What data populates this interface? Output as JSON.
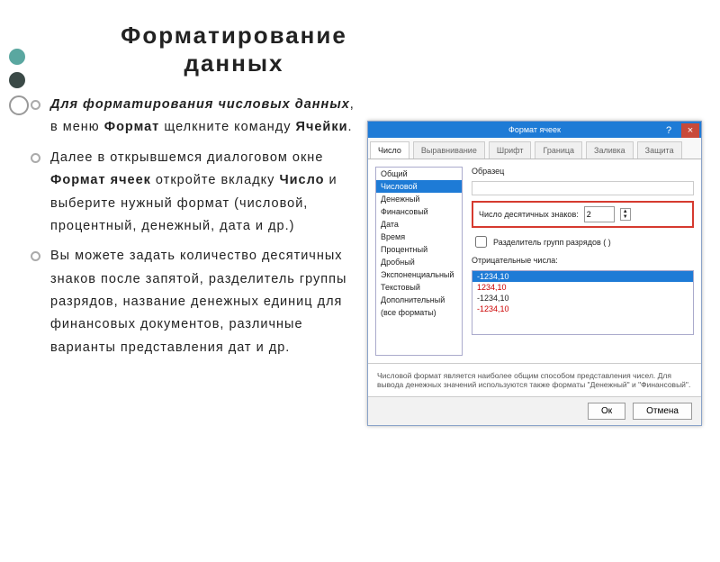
{
  "title": "Форматирование  данных",
  "bullets": [
    "<i><b>Для форматирования числовых данных</b></i>, в меню <b>Формат</b> щелкните команду <b>Ячейки</b>.",
    "Далее в открывшемся диалоговом окне <b>Формат ячеек</b> откройте вкладку <b>Число</b> и выберите нужный формат (числовой, процентный, денежный, дата и др.)",
    "Вы можете задать количество десятичных знаков после запятой, разделитель группы разрядов, название денежных единиц для финансовых документов, различные варианты представления дат и др."
  ],
  "dialog": {
    "title": "Формат ячеек",
    "help": "?",
    "close": "×",
    "tabs": [
      "Число",
      "Выравнивание",
      "Шрифт",
      "Граница",
      "Заливка",
      "Защита"
    ],
    "active_tab": 0,
    "formats": [
      "Общий",
      "Числовой",
      "Денежный",
      "Финансовый",
      "Дата",
      "Время",
      "Процентный",
      "Дробный",
      "Экспоненциальный",
      "Текстовый",
      "Дополнительный",
      "(все форматы)"
    ],
    "selected_format": 1,
    "sample_label": "Образец",
    "decimals_label": "Число десятичных знаков:",
    "decimals_value": "2",
    "group_sep_label": "Разделитель групп разрядов ( )",
    "neg_label": "Отрицательные числа:",
    "neg_options": [
      "-1234,10",
      "1234,10",
      "-1234,10",
      "-1234,10"
    ],
    "neg_selected": 0,
    "hint": "Числовой формат является наиболее общим способом представления чисел. Для вывода денежных значений используются также форматы \"Денежный\" и \"Финансовый\".",
    "ok": "Ок",
    "cancel": "Отмена"
  }
}
